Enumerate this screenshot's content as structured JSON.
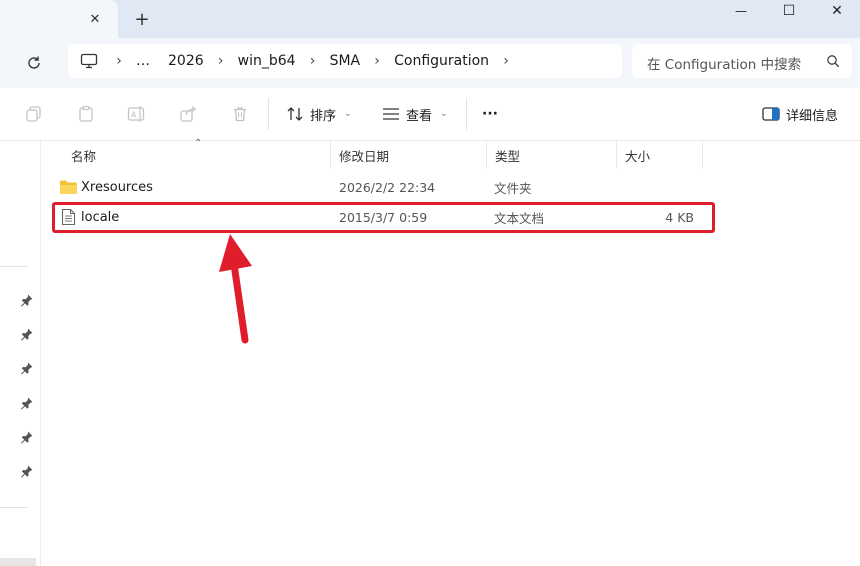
{
  "tab": {
    "title": "",
    "close": "✕",
    "new": "+"
  },
  "window": {
    "minimize": "—",
    "maximize": "☐",
    "close": "✕"
  },
  "address": {
    "crumbs": [
      "…",
      "2026",
      "win_b64",
      "SMA",
      "Configuration"
    ],
    "separator": "›"
  },
  "search": {
    "placeholder": "在 Configuration 中搜索"
  },
  "toolbar": {
    "sort_label": "排序",
    "view_label": "查看",
    "more_label": "···",
    "details_label": "详细信息"
  },
  "columns": {
    "name": "名称",
    "modified": "修改日期",
    "type": "类型",
    "size": "大小"
  },
  "files": [
    {
      "name": "Xresources",
      "modified": "2026/2/2 22:34",
      "type": "文件夹",
      "size": "",
      "icon": "folder-icon"
    },
    {
      "name": "locale",
      "modified": "2015/3/7 0:59",
      "type": "文本文档",
      "size": "4 KB",
      "icon": "text-file-icon"
    }
  ],
  "colors": {
    "highlight": "#e01e2b",
    "titlebar": "#dfe8f3",
    "navbar": "#f3f6fa",
    "folder": "#f4c23a"
  }
}
